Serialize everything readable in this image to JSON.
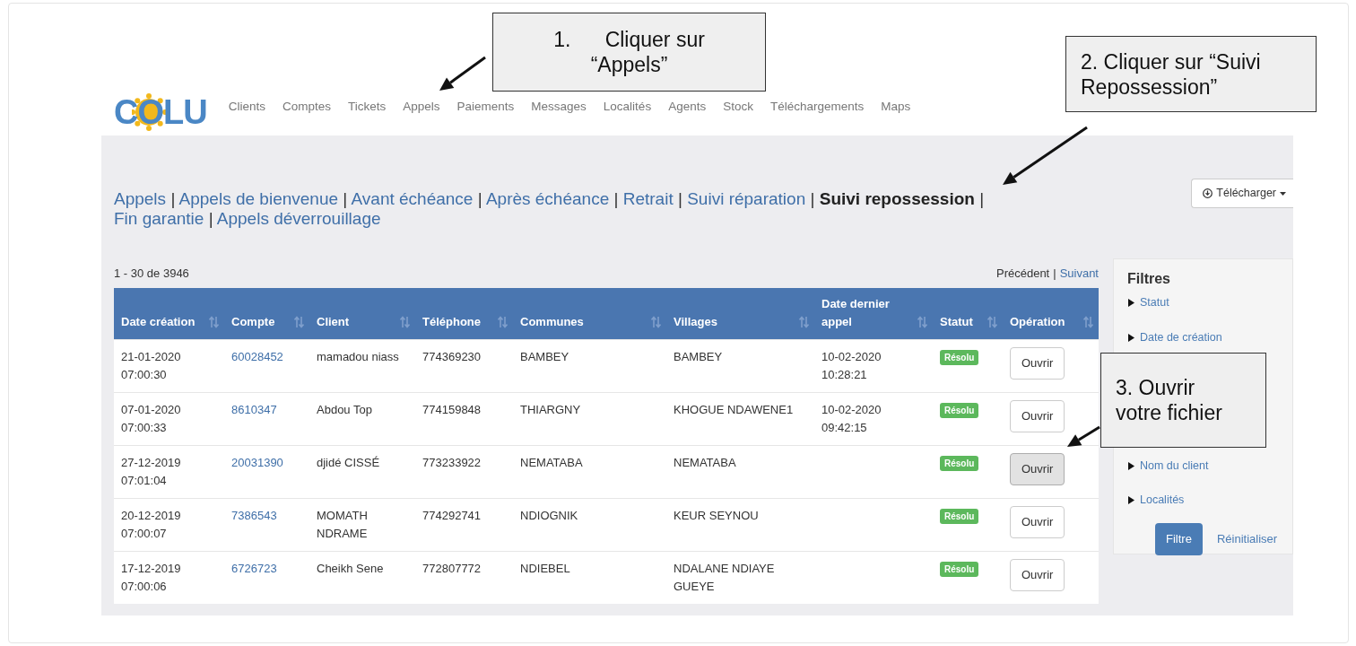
{
  "logo": "COLU",
  "nav": [
    "Clients",
    "Comptes",
    "Tickets",
    "Appels",
    "Paiements",
    "Messages",
    "Localités",
    "Agents",
    "Stock",
    "Téléchargements",
    "Maps"
  ],
  "call_tabs": {
    "separator": "|",
    "items": [
      {
        "label": "Appels",
        "selected": false
      },
      {
        "label": "Appels de bienvenue",
        "selected": false
      },
      {
        "label": "Avant échéance",
        "selected": false
      },
      {
        "label": "Après échéance",
        "selected": false
      },
      {
        "label": "Retrait",
        "selected": false
      },
      {
        "label": "Suivi réparation",
        "selected": false
      },
      {
        "label": "Suivi repossession",
        "selected": true
      },
      {
        "label": "Fin garantie",
        "selected": false
      },
      {
        "label": "Appels déverrouillage",
        "selected": false
      }
    ]
  },
  "download_button": "Télécharger",
  "count": "1 - 30 de 3946",
  "pagination": {
    "previous": {
      "label": "Précédent",
      "disabled": true
    },
    "separator": "|",
    "next": {
      "label": "Suivant",
      "disabled": false
    }
  },
  "table": {
    "columns": [
      "Date création",
      "Compte",
      "Client",
      "Téléphone",
      "Communes",
      "Villages",
      "Date dernier appel",
      "Statut",
      "Opération"
    ],
    "rows": [
      {
        "date_creation": "21-01-2020 07:00:30",
        "compte": "60028452",
        "client": "mamadou niass",
        "telephone": "774369230",
        "commune": "BAMBEY",
        "village": "BAMBEY",
        "dernier_appel": "10-02-2020 10:28:21",
        "statut": "Résolu",
        "operation": "Ouvrir",
        "hovered": false
      },
      {
        "date_creation": "07-01-2020 07:00:33",
        "compte": "8610347",
        "client": "Abdou Top",
        "telephone": "774159848",
        "commune": "THIARGNY",
        "village": "KHOGUE NDAWENE1",
        "dernier_appel": "10-02-2020 09:42:15",
        "statut": "Résolu",
        "operation": "Ouvrir",
        "hovered": false
      },
      {
        "date_creation": "27-12-2019 07:01:04",
        "compte": "20031390",
        "client": "djidé CISSÉ",
        "telephone": "773233922",
        "commune": "NEMATABA",
        "village": "NEMATABA",
        "statut": "Résolu",
        "operation": "Ouvrir",
        "hovered": true
      },
      {
        "date_creation": "20-12-2019 07:00:07",
        "compte": "7386543",
        "client": "MOMATH NDRAME",
        "telephone": "774292741",
        "commune": "NDIOGNIK",
        "village": "KEUR SEYNOU",
        "statut": "Résolu",
        "operation": "Ouvrir",
        "hovered": false
      },
      {
        "date_creation": "17-12-2019 07:00:06",
        "compte": "6726723",
        "client": "Cheikh Sene",
        "telephone": "772807772",
        "commune": "NDIEBEL",
        "village": "NDALANE NDIAYE GUEYE",
        "statut": "Résolu",
        "operation": "Ouvrir",
        "hovered": false
      }
    ]
  },
  "filters": {
    "title": "Filtres",
    "items": [
      {
        "label": "Statut",
        "expanded": false
      },
      {
        "label": "Date de création",
        "expanded": false
      },
      {
        "label": "Nom du client",
        "expanded": false
      },
      {
        "label": "Localités",
        "expanded": false
      }
    ],
    "apply": "Filtre",
    "reset": "Réinitialiser"
  },
  "callouts": [
    {
      "lines": [
        "1.      Cliquer sur",
        "“Appels”"
      ]
    },
    {
      "lines": [
        "2. Cliquer sur “Suivi",
        "Repossession”"
      ]
    },
    {
      "lines": [
        "3. Ouvrir",
        "votre fichier"
      ]
    }
  ]
}
